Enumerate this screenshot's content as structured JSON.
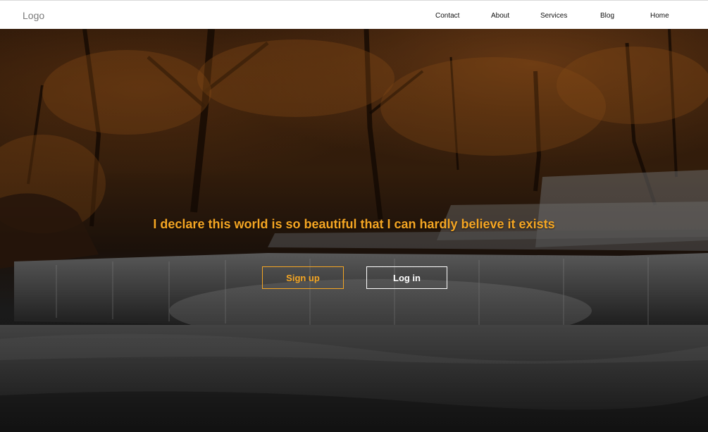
{
  "navbar": {
    "logo": "Logo",
    "links": [
      "Contact",
      "About",
      "Services",
      "Blog",
      "Home"
    ]
  },
  "hero": {
    "headline": "I declare this world is so beautiful that I can hardly believe it exists",
    "signup_label": "Sign up",
    "login_label": "Log in"
  },
  "colors": {
    "accent": "#f5a623",
    "navbar_bg": "#ffffff",
    "button_outline_light": "#ffffff"
  }
}
